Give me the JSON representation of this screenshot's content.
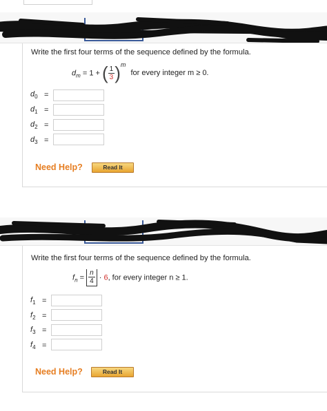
{
  "problem1": {
    "prompt": "Write the first four terms of the sequence defined by the formula.",
    "formula": {
      "lhs_var": "d",
      "lhs_sub": "m",
      "eq_text": "= 1 +",
      "frac_num": "1",
      "frac_den": "3",
      "exponent": "m",
      "tail": "for every integer m ≥ 0."
    },
    "rows": [
      {
        "var": "d",
        "sub": "0",
        "eq": "=",
        "value": ""
      },
      {
        "var": "d",
        "sub": "1",
        "eq": "=",
        "value": ""
      },
      {
        "var": "d",
        "sub": "2",
        "eq": "=",
        "value": ""
      },
      {
        "var": "d",
        "sub": "3",
        "eq": "=",
        "value": ""
      }
    ],
    "need_help": "Need Help?",
    "read_it": "Read It"
  },
  "problem2": {
    "prompt": "Write the first four terms of the sequence defined by the formula.",
    "formula": {
      "lhs_var": "f",
      "lhs_sub": "n",
      "eq_text": "=",
      "frac_num": "n",
      "frac_den": "4",
      "dot": "·",
      "red_val": "6",
      "tail": ", for every integer n ≥ 1."
    },
    "rows": [
      {
        "var": "f",
        "sub": "1",
        "eq": "=",
        "value": ""
      },
      {
        "var": "f",
        "sub": "2",
        "eq": "=",
        "value": ""
      },
      {
        "var": "f",
        "sub": "3",
        "eq": "=",
        "value": ""
      },
      {
        "var": "f",
        "sub": "4",
        "eq": "=",
        "value": ""
      }
    ],
    "need_help": "Need Help?",
    "read_it": "Read It"
  },
  "colors": {
    "accent_orange": "#e67e22",
    "red_value": "#d0312d",
    "redaction": "#111111",
    "border_blue": "#3a5a99"
  }
}
